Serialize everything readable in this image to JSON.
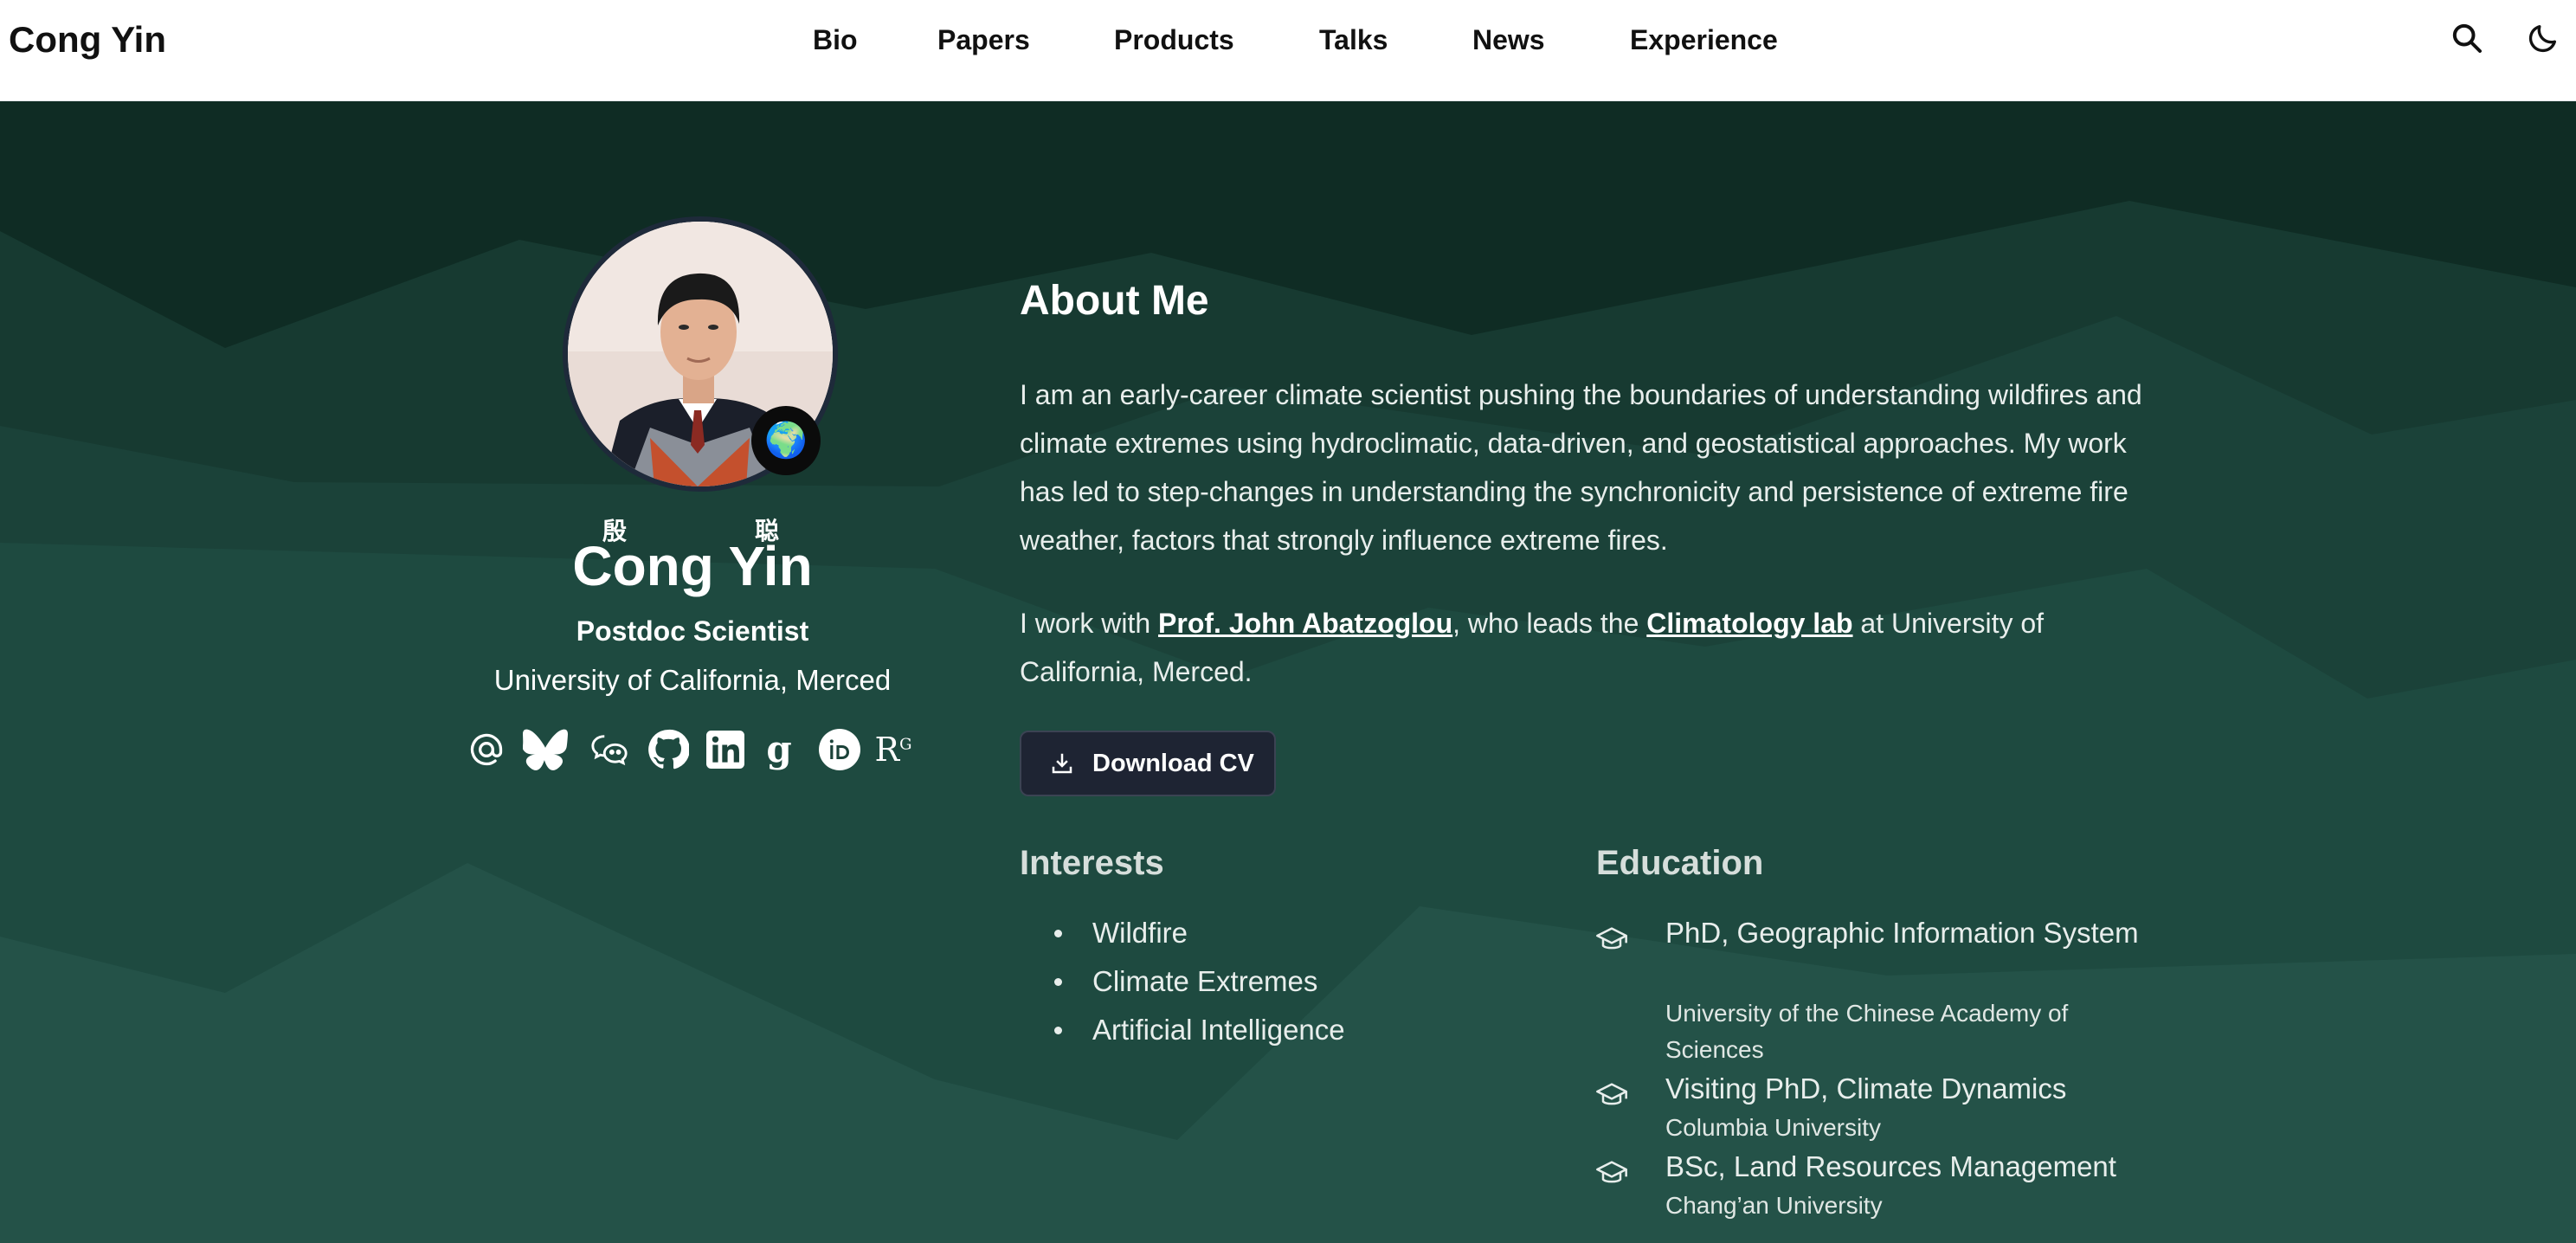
{
  "nav": {
    "brand": "Cong Yin",
    "links": [
      {
        "label": "Bio"
      },
      {
        "label": "Papers"
      },
      {
        "label": "Products"
      },
      {
        "label": "Talks"
      },
      {
        "label": "News"
      },
      {
        "label": "Experience"
      }
    ],
    "icons": [
      "search-icon",
      "moon-icon"
    ]
  },
  "profile": {
    "avatar_badge": "🌍",
    "name_cjk": [
      "殷",
      "聪"
    ],
    "name": "Cong Yin",
    "role": "Postdoc Scientist",
    "organization": "University of California, Merced",
    "social_icons": [
      "email-icon",
      "bluesky-icon",
      "wechat-icon",
      "github-icon",
      "linkedin-icon",
      "google-scholar-icon",
      "orcid-icon",
      "researchgate-icon"
    ]
  },
  "about": {
    "title": "About Me",
    "paragraph1": "I am an early-career climate scientist pushing the boundaries of understanding wildfires and climate extremes using hydroclimatic, data-driven, and geostatistical approaches. My work has led to step-changes in understanding the synchronicity and persistence of extreme fire weather, factors that strongly influence extreme fires.",
    "paragraph2": {
      "prefix": "I work with ",
      "link1": "Prof. John Abatzoglou",
      "middle": ", who leads the ",
      "link2": "Climatology lab",
      "suffix": " at University of California, Merced."
    },
    "cv_button": "Download CV"
  },
  "interests": {
    "title": "Interests",
    "items": [
      "Wildfire",
      "Climate Extremes",
      "Artificial Intelligence"
    ]
  },
  "education": {
    "title": "Education",
    "items": [
      {
        "degree": "PhD, Geographic Information System",
        "school": "University of the Chinese Academy of Sciences"
      },
      {
        "degree": "Visiting PhD, Climate Dynamics",
        "school": "Columbia University"
      },
      {
        "degree": "BSc, Land Resources Management",
        "school": "Chang’an University"
      }
    ]
  },
  "colors": {
    "hero_dark": "#0f2c24",
    "hero_mid": "#1b4239",
    "hero_light": "#25584d",
    "button_bg": "#1e2433"
  }
}
